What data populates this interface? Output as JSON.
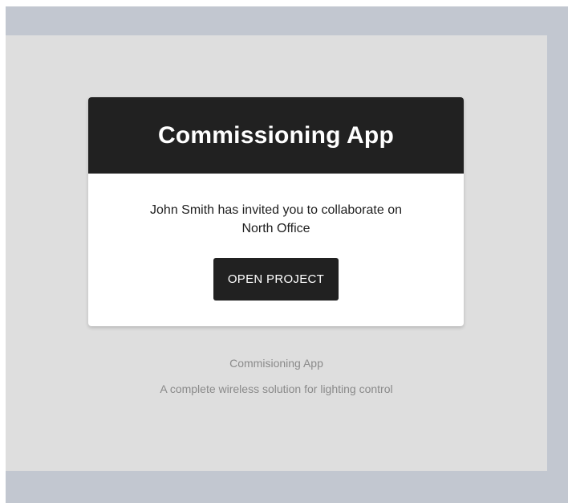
{
  "header": {
    "title": "Commissioning App"
  },
  "invite": {
    "message": "John Smith has invited you to collaborate on",
    "project": "North Office"
  },
  "actions": {
    "open_project_label": "OPEN PROJECT"
  },
  "footer": {
    "app_name": "Commisioning App",
    "tagline": "A complete wireless solution for lighting control"
  },
  "colors": {
    "header_bg": "#212121",
    "button_bg": "#212121",
    "canvas_bg": "#dedede",
    "page_bg": "#c2c7d0"
  }
}
